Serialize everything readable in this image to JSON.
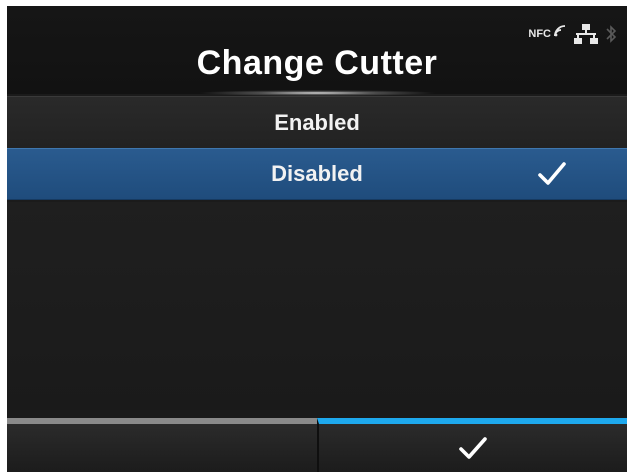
{
  "header": {
    "title": "Change Cutter",
    "status": {
      "nfc_label": "NFC",
      "icons": [
        "nfc-icon",
        "network-icon",
        "bluetooth-icon"
      ]
    }
  },
  "options": [
    {
      "label": "Enabled",
      "selected": false
    },
    {
      "label": "Disabled",
      "selected": true,
      "check_icon": "checkmark-icon"
    }
  ],
  "softkeys": {
    "left": {
      "label": ""
    },
    "right": {
      "icon": "checkmark-icon"
    }
  },
  "colors": {
    "selected_row": "#1f4c7c",
    "accent": "#1ea9ee",
    "left_key_bar": "#8a8a8a",
    "background": "#1b1b1b"
  }
}
